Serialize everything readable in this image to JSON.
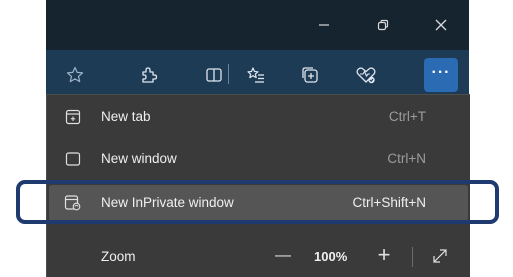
{
  "window_controls": {
    "minimize_icon": "minimize-icon",
    "restore_icon": "restore-icon",
    "close_icon": "close-icon"
  },
  "toolbar": {
    "buttons": [
      {
        "name": "favorite-star-icon"
      },
      {
        "name": "extensions-puzzle-icon"
      },
      {
        "name": "split-screen-icon"
      },
      {
        "name": "favorites-list-icon"
      },
      {
        "name": "collections-icon"
      },
      {
        "name": "performance-heart-icon"
      },
      {
        "name": "more-ellipsis-icon",
        "label": "···"
      }
    ]
  },
  "menu": {
    "items": [
      {
        "label": "New tab",
        "shortcut": "Ctrl+T",
        "icon": "new-tab-icon"
      },
      {
        "label": "New window",
        "shortcut": "Ctrl+N",
        "icon": "new-window-icon"
      },
      {
        "label": "New InPrivate window",
        "shortcut": "Ctrl+Shift+N",
        "icon": "inprivate-window-icon",
        "highlighted": true
      }
    ],
    "zoom": {
      "label": "Zoom",
      "value": "100%",
      "minus": "—",
      "plus": "+"
    }
  },
  "colors": {
    "titlebar": "#16242f",
    "toolbar": "#1e3b56",
    "menu_bg": "#3a3a3a",
    "highlight_border": "#1e3a6e",
    "active_button": "#2b6bb3"
  }
}
